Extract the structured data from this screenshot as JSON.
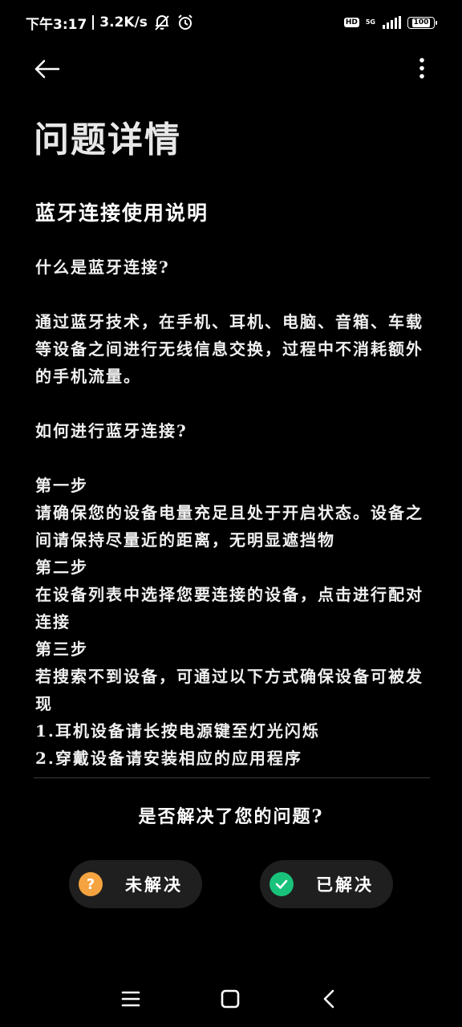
{
  "status_bar": {
    "time": "下午3:17",
    "net_speed": "3.2K/s",
    "net_type": "5G",
    "hd_label": "HD",
    "battery": "100"
  },
  "icons": {
    "back": "arrow-left-icon",
    "more": "more-vertical-icon",
    "unsolved": "question-circle-icon",
    "solved": "check-circle-icon",
    "nav_menu": "menu-lines-icon",
    "nav_home": "square-icon",
    "nav_back": "chevron-left-icon"
  },
  "colors": {
    "background": "#000000",
    "unsolved_icon": "#f4a340",
    "solved_icon": "#18c27a",
    "pill_bg": "#1f1f1f"
  },
  "page": {
    "title": "问题详情"
  },
  "article": {
    "title": "蓝牙连接使用说明",
    "q1": "什么是蓝牙连接?",
    "a1": "通过蓝牙技术，在手机、耳机、电脑、音箱、车载等设备之间进行无线信息交换，过程中不消耗额外的手机流量。",
    "q2": "如何进行蓝牙连接?",
    "step1_title": "第一步",
    "step1_text": "请确保您的设备电量充足且处于开启状态。设备之间请保持尽量近的距离，无明显遮挡物",
    "step2_title": "第二步",
    "step2_text": "在设备列表中选择您要连接的设备，点击进行配对连接",
    "step3_title": "第三步",
    "step3_text": "若搜索不到设备，可通过以下方式确保设备可被发现",
    "tip1": "1.耳机设备请长按电源键至灯光闪烁",
    "tip2": "2.穿戴设备请安装相应的应用程序"
  },
  "feedback": {
    "question": "是否解决了您的问题?",
    "unsolved_label": "未解决",
    "unsolved_glyph": "?",
    "solved_label": "已解决"
  }
}
